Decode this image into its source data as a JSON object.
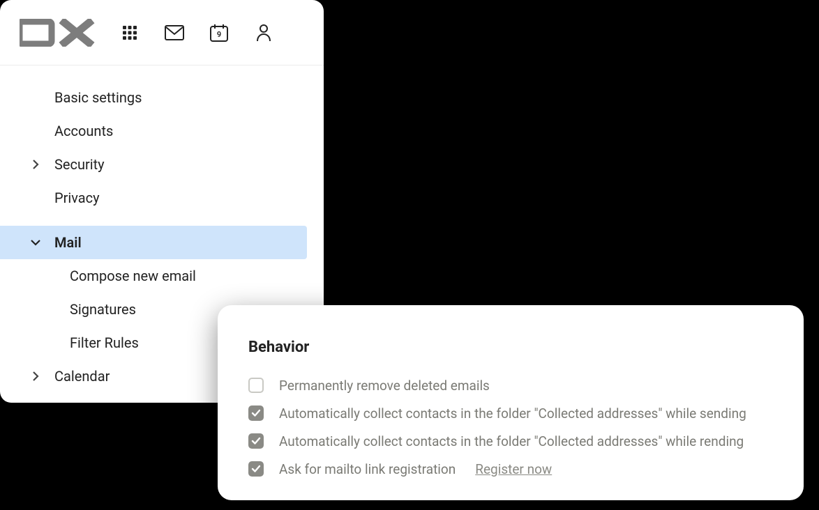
{
  "topbar": {
    "calendar_day": "9"
  },
  "sidebar": {
    "items": [
      {
        "label": "Basic settings",
        "expandable": false
      },
      {
        "label": "Accounts",
        "expandable": false
      },
      {
        "label": "Security",
        "expandable": true,
        "expanded": false
      },
      {
        "label": "Privacy",
        "expandable": false
      },
      {
        "label": "Mail",
        "expandable": true,
        "expanded": true,
        "selected": true,
        "children": [
          {
            "label": "Compose new email"
          },
          {
            "label": "Signatures"
          },
          {
            "label": "Filter Rules"
          }
        ]
      },
      {
        "label": "Calendar",
        "expandable": true,
        "expanded": false
      }
    ]
  },
  "behavior": {
    "title": "Behavior",
    "options": [
      {
        "label": "Permanently remove deleted emails",
        "checked": false
      },
      {
        "label": "Automatically collect contacts in the folder \"Collected addresses\" while sending",
        "checked": true
      },
      {
        "label": "Automatically collect contacts in the folder \"Collected addresses\" while rending",
        "checked": true
      },
      {
        "label": "Ask for mailto link registration",
        "checked": true,
        "link": "Register now"
      }
    ]
  }
}
